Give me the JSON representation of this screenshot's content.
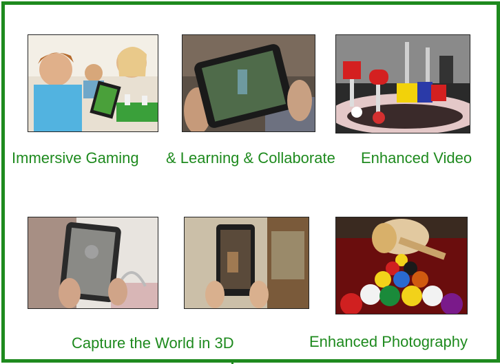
{
  "colors": {
    "border": "#1e8a1e",
    "caption": "#1e8a1e"
  },
  "features": [
    {
      "label": "Immersive Gaming",
      "image": "gaming-photo"
    },
    {
      "label": "& Learning & Collaborate",
      "image": "learning-photo"
    },
    {
      "label": "Enhanced Video",
      "image": "video-photo"
    },
    {
      "label": "Capture the World in 3D",
      "image": "capture-photo-1"
    },
    {
      "label": "",
      "image": "capture-photo-2"
    },
    {
      "label": "Enhanced Photography",
      "image": "photography-photo"
    }
  ]
}
